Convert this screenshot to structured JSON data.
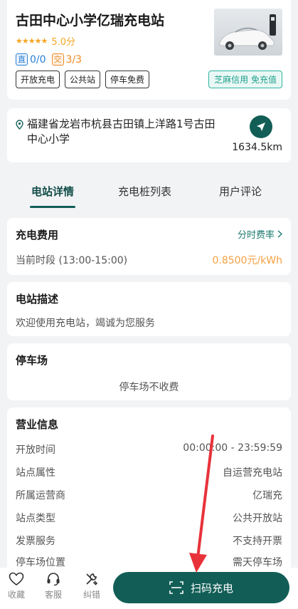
{
  "station": {
    "name": "古田中心小学亿瑞充电站",
    "stars": "★★★★★",
    "score": "5.0分",
    "dc_badge": "直",
    "dc_count": "0/0",
    "ac_badge": "交",
    "ac_count": "3/3",
    "tags": [
      "开放充电",
      "公共站",
      "停车免费"
    ],
    "zhima": "芝麻信用 免充值"
  },
  "address": {
    "text": "福建省龙岩市杭县古田镇上洋路1号古田中心小学",
    "distance": "1634.5km"
  },
  "tabs": [
    {
      "label": "电站详情",
      "active": true
    },
    {
      "label": "充电桩列表",
      "active": false
    },
    {
      "label": "用户评论",
      "active": false
    }
  ],
  "fee": {
    "title": "充电费用",
    "link": "分时费率",
    "period": "当前时段 (13:00-15:00)",
    "price": "0.8500元/kWh"
  },
  "desc": {
    "title": "电站描述",
    "text": "欢迎使用充电站，竭诚为您服务"
  },
  "parking": {
    "title": "停车场",
    "text": "停车场不收费"
  },
  "business": {
    "title": "营业信息",
    "rows": [
      {
        "label": "开放时间",
        "value": "00:00:00 - 23:59:59"
      },
      {
        "label": "站点属性",
        "value": "自运营充电站"
      },
      {
        "label": "所属运营商",
        "value": "亿瑞充"
      },
      {
        "label": "站点类型",
        "value": "公共开放站"
      },
      {
        "label": "发票服务",
        "value": "不支持开票"
      },
      {
        "label": "停车场位置",
        "value": "需天停车场"
      }
    ]
  },
  "bottom": {
    "favorite": "收藏",
    "service": "客服",
    "report": "纠错",
    "scan": "扫码充电"
  },
  "colors": {
    "primary": "#125e57",
    "price": "#f5a041",
    "dc": "#2a7fd4",
    "ac": "#f08a24",
    "annotation": "#e8323a"
  }
}
